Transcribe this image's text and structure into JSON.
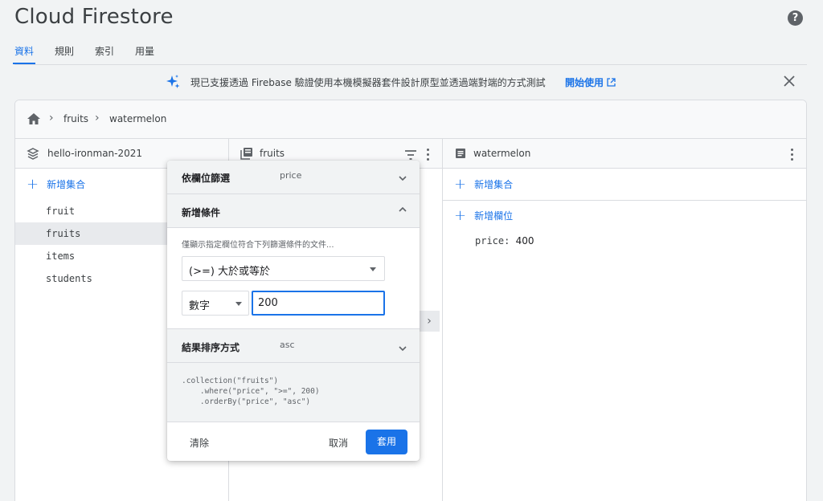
{
  "app": {
    "title": "Cloud Firestore",
    "help_icon": "help-icon"
  },
  "tabs": [
    {
      "label": "資料",
      "active": true
    },
    {
      "label": "規則",
      "active": false
    },
    {
      "label": "索引",
      "active": false
    },
    {
      "label": "用量",
      "active": false
    }
  ],
  "banner": {
    "text": "現已支援透過 Firebase 驗證使用本機模擬器套件設計原型並透過端對端的方式測試",
    "link": "開始使用"
  },
  "breadcrumb": [
    "fruits",
    "watermelon"
  ],
  "columns": {
    "project": {
      "title": "hello-ironman-2021",
      "add_label": "新增集合",
      "items": [
        "fruit",
        "fruits",
        "items",
        "students"
      ],
      "selected": "fruits"
    },
    "collection": {
      "title": "fruits"
    },
    "document": {
      "title": "watermelon",
      "add_collection": "新增集合",
      "add_field": "新增欄位",
      "fields": [
        {
          "key": "price",
          "value": "400"
        }
      ]
    }
  },
  "filter_dialog": {
    "field_filter_label": "依欄位篩選",
    "field_filter_value": "price",
    "add_condition_label": "新增條件",
    "hint": "僅顯示指定欄位符合下列篩選條件的文件...",
    "operator": "(>=) 大於或等於",
    "type": "數字",
    "value": "200",
    "sort_label": "結果排序方式",
    "sort_value": "asc",
    "code": ".collection(\"fruits\")\n    .where(\"price\", \">=\", 200)\n    .orderBy(\"price\", \"asc\")",
    "clear": "清除",
    "cancel": "取消",
    "apply": "套用"
  },
  "colors": {
    "accent": "#1a73e8",
    "text": "#3c4043"
  }
}
